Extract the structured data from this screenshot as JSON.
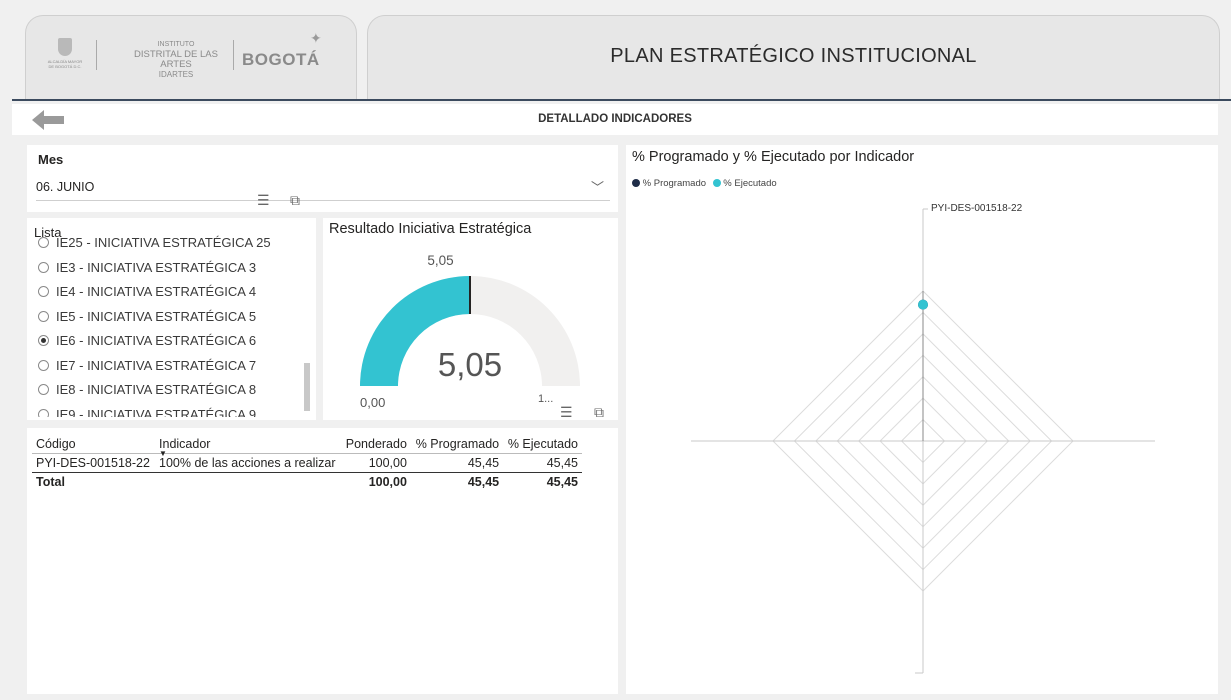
{
  "header": {
    "logo_line1": "INSTITUTO",
    "logo_line2": "DISTRITAL DE LAS ARTES",
    "logo_line3": "IDARTES",
    "logo_brand": "BOGOTÁ",
    "logo_small": "ALCALDÍA MAYOR DE BOGOTÁ D.C.",
    "title": "PLAN ESTRATÉGICO INSTITUCIONAL"
  },
  "subheader": {
    "title": "DETALLADO INDICADORES"
  },
  "month_slicer": {
    "label": "Mes",
    "value": "06. JUNIO"
  },
  "list_slicer": {
    "label": "Lista",
    "items": [
      {
        "label": "IE25 - INICIATIVA ESTRATÉGICA 25",
        "selected": false
      },
      {
        "label": "IE3 - INICIATIVA ESTRATÉGICA 3",
        "selected": false
      },
      {
        "label": "IE4 - INICIATIVA ESTRATÉGICA 4",
        "selected": false
      },
      {
        "label": "IE5 - INICIATIVA ESTRATÉGICA 5",
        "selected": false
      },
      {
        "label": "IE6 - INICIATIVA ESTRATÉGICA 6",
        "selected": true
      },
      {
        "label": "IE7 - INICIATIVA ESTRATÉGICA 7",
        "selected": false
      },
      {
        "label": "IE8 - INICIATIVA ESTRATÉGICA 8",
        "selected": false
      },
      {
        "label": "IE9 - INICIATIVA ESTRATÉGICA 9",
        "selected": false
      }
    ]
  },
  "gauge": {
    "title": "Resultado Iniciativa Estratégica",
    "value": 5.05,
    "value_label": "5,05",
    "target_label": "5,05",
    "min": 0,
    "max": 10.1,
    "min_label": "0,00",
    "max_label": "1...",
    "fill_color": "#33c3d1",
    "track_color": "#f1f0ef"
  },
  "table": {
    "headers": [
      "Código",
      "Indicador",
      "Ponderado",
      "% Programado",
      "% Ejecutado"
    ],
    "rows": [
      [
        "PYI-DES-001518-22",
        "100% de las acciones a realizar",
        "100,00",
        "45,45",
        "45,45"
      ]
    ],
    "total": [
      "Total",
      "",
      "100,00",
      "45,45",
      "45,45"
    ]
  },
  "radar": {
    "title": "% Programado y % Ejecutado por Indicador",
    "legend": [
      {
        "name": "% Programado",
        "color": "#1f2d48"
      },
      {
        "name": "% Ejecutado",
        "color": "#33c3d1"
      }
    ],
    "axis_label": "PYI-DES-001518-22"
  },
  "chart_data": {
    "type": "radar",
    "title": "% Programado y % Ejecutado por Indicador",
    "categories": [
      "PYI-DES-001518-22"
    ],
    "series": [
      {
        "name": "% Programado",
        "values": [
          45.45
        ]
      },
      {
        "name": "% Ejecutado",
        "values": [
          45.45
        ]
      }
    ],
    "legend_position": "top-left"
  }
}
